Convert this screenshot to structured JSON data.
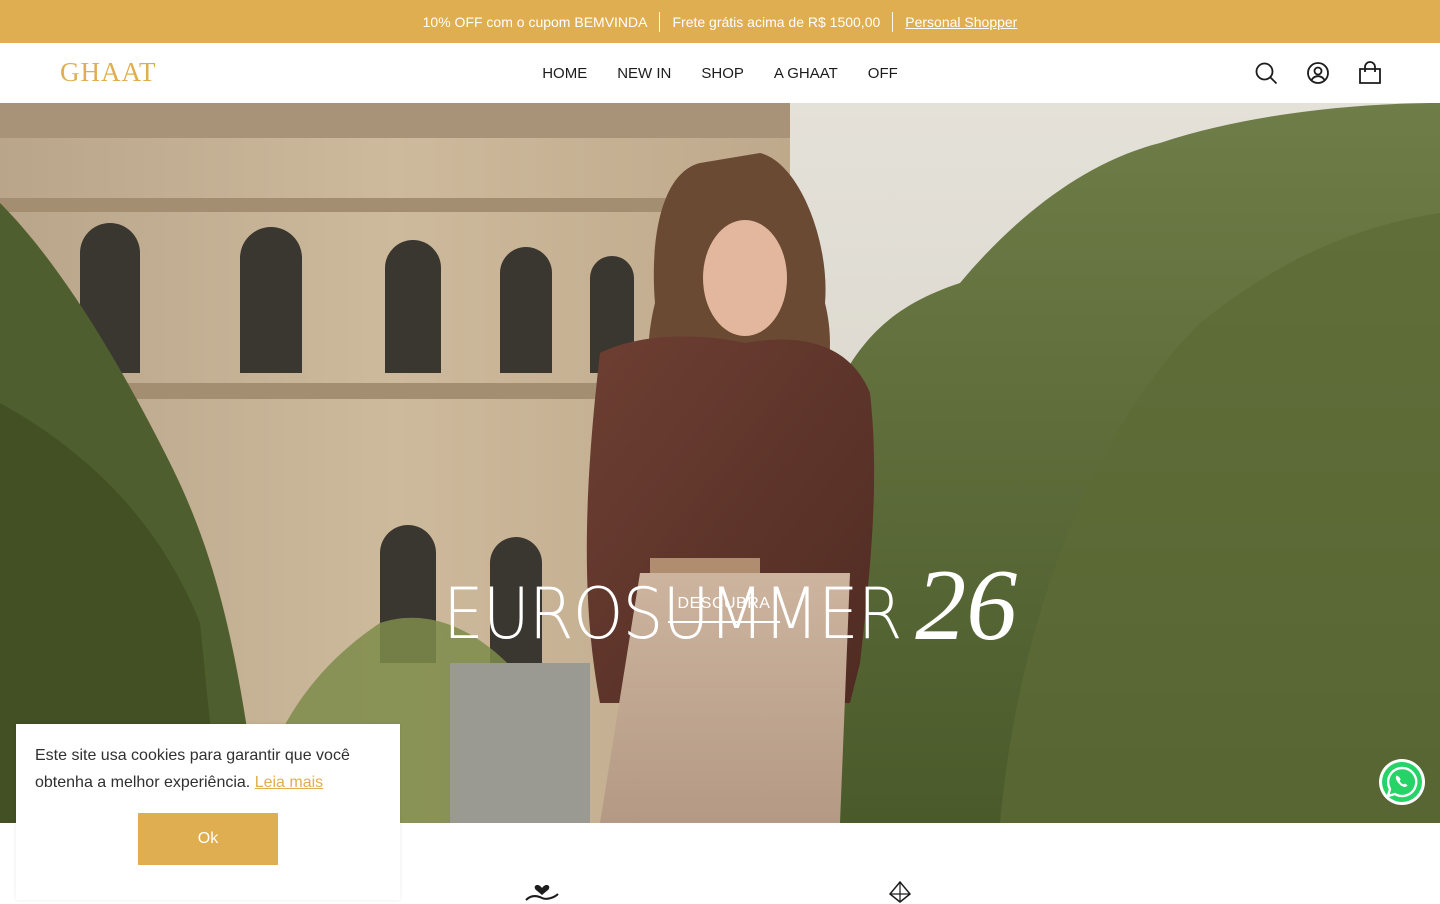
{
  "announcement": {
    "coupon": "10% OFF com o cupom BEMVINDA",
    "shipping": "Frete grátis acima de R$ 1500,00",
    "shopper_link": "Personal Shopper"
  },
  "header": {
    "logo": "GHAAT",
    "nav": [
      "HOME",
      "NEW IN",
      "SHOP",
      "A GHAAT",
      "OFF"
    ]
  },
  "icons": {
    "search": "search-icon",
    "account": "account-icon",
    "cart": "shopping-bag-icon",
    "whatsapp": "whatsapp-icon"
  },
  "hero": {
    "title_main": "EUROSUMMER",
    "title_number": "26",
    "cta": "DESCUBRA"
  },
  "cookie": {
    "message": "Este site usa cookies para garantir que você obtenha a melhor experiência.",
    "link": "Leia mais",
    "button": "Ok"
  },
  "colors": {
    "accent": "#dfae50",
    "text": "#1c1c1c",
    "whatsapp": "#25d366"
  }
}
